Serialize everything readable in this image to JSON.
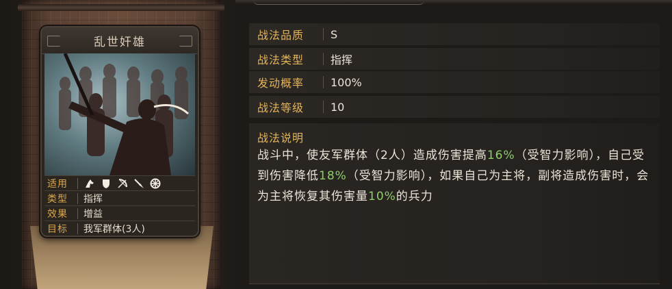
{
  "card": {
    "title": "乱世奸雄",
    "rows": [
      {
        "label": "适用",
        "icons": [
          "horse-icon",
          "shield-icon",
          "bow-icon",
          "spear-icon",
          "wheel-icon"
        ]
      },
      {
        "label": "类型",
        "value": "指挥"
      },
      {
        "label": "效果",
        "value": "增益"
      },
      {
        "label": "目标",
        "value": "我军群体(3人)"
      }
    ]
  },
  "properties": [
    {
      "label": "战法品质",
      "value": "S"
    },
    {
      "label": "战法类型",
      "value": "指挥"
    },
    {
      "label": "发动概率",
      "value": "100%"
    },
    {
      "label": "战法等级",
      "value": "10"
    }
  ],
  "description": {
    "title": "战法说明",
    "segments": [
      {
        "text": "战斗中，使友军群体（2人）造成伤害提高",
        "highlight": false
      },
      {
        "text": "16%",
        "highlight": true
      },
      {
        "text": "（受智力影响），自己受到伤害降低",
        "highlight": false
      },
      {
        "text": "18%",
        "highlight": true
      },
      {
        "text": "（受智力影响），如果自己为主将，副将造成伤害时，会为主将恢复其伤害量",
        "highlight": false
      },
      {
        "text": "10%",
        "highlight": true
      },
      {
        "text": "的兵力",
        "highlight": false
      }
    ]
  },
  "colors": {
    "accent_gold": "#e3b45a",
    "highlight_green": "#8fcf6a",
    "text": "#ece4d8"
  }
}
